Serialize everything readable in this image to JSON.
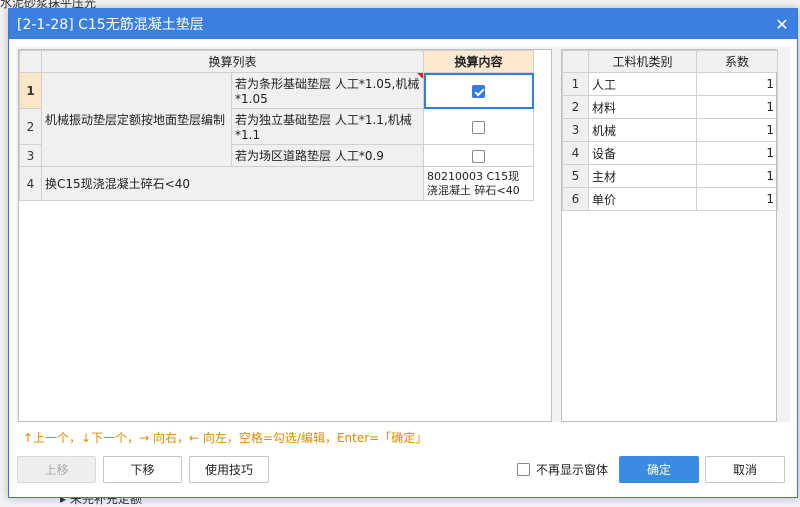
{
  "background": {
    "top_text": "水泥砂浆抹平压光",
    "bottom_text": "▸ 未完补充定额"
  },
  "dialog": {
    "title": "[2-1-28] C15无筋混凝土垫层",
    "close_icon": "close-icon"
  },
  "left_table": {
    "headers": {
      "col1": "换算列表",
      "col2": "换算内容"
    },
    "group_label": "机械振动垫层定额按地面垫层编制",
    "rows": [
      {
        "num": "1",
        "item": "若为条形基础垫层 人工*1.05,机械*1.05",
        "checked": true
      },
      {
        "num": "2",
        "item": "若为独立基础垫层 人工*1.1,机械*1.1",
        "checked": false
      },
      {
        "num": "3",
        "item": "若为场区道路垫层 人工*0.9",
        "checked": false
      }
    ],
    "row4": {
      "num": "4",
      "label": "换C15现浇混凝土碎石<40",
      "content": "80210003  C15现浇混凝土 碎石<40"
    }
  },
  "right_table": {
    "headers": {
      "col1": "工料机类别",
      "col2": "系数"
    },
    "rows": [
      {
        "num": "1",
        "category": "人工",
        "coef": "1"
      },
      {
        "num": "2",
        "category": "材料",
        "coef": "1"
      },
      {
        "num": "3",
        "category": "机械",
        "coef": "1"
      },
      {
        "num": "4",
        "category": "设备",
        "coef": "1"
      },
      {
        "num": "5",
        "category": "主材",
        "coef": "1"
      },
      {
        "num": "6",
        "category": "单价",
        "coef": "1"
      }
    ]
  },
  "hint": "↑上一个，↓下一个，→ 向右，← 向左，空格=勾选/编辑，Enter=「确定」",
  "footer": {
    "up_label": "上移",
    "down_label": "下移",
    "tips_label": "使用技巧",
    "dont_show_label": "不再显示窗体",
    "ok_label": "确定",
    "cancel_label": "取消"
  },
  "colors": {
    "titlebar": "#3b7fe0",
    "accent": "#3b8be5",
    "hint": "#e08a00"
  }
}
